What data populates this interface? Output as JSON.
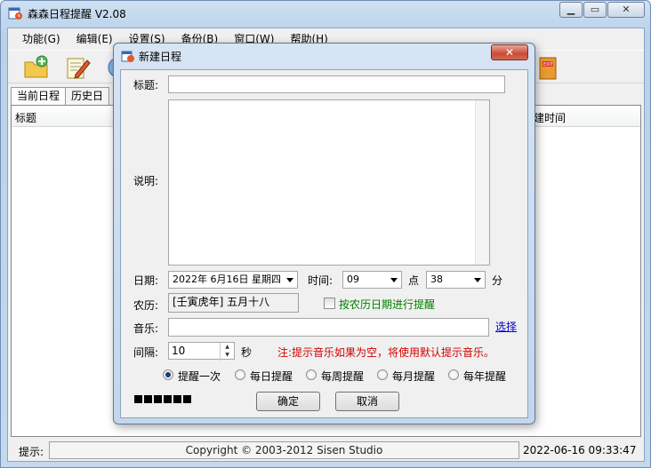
{
  "app": {
    "title": "森森日程提醒 V2.08",
    "window_buttons": [
      "▁",
      "▭",
      "✕"
    ]
  },
  "menu": [
    "功能(G)",
    "编辑(E)",
    "设置(S)",
    "备份(B)",
    "窗口(W)",
    "帮助(H)"
  ],
  "tabs": [
    "当前日程",
    "历史日"
  ],
  "list": {
    "col_title": "标题",
    "col_created": "建时间"
  },
  "status": {
    "label": "提示:",
    "message": "Copyright © 2003-2012 Sisen Studio",
    "datetime": "2022-06-16 09:33:47"
  },
  "dialog": {
    "title": "新建日程",
    "close": "✕",
    "title_label": "标题:",
    "title_value": "",
    "desc_label": "说明:",
    "desc_value": "",
    "date_label": "日期:",
    "date_value": "2022年 6月16日 星期四",
    "time_label": "时间:",
    "hour_value": "09",
    "hour_unit": "点",
    "minute_value": "38",
    "minute_unit": "分",
    "lunar_label": "农历:",
    "lunar_value": "[壬寅虎年] 五月十八",
    "lunar_check_label": "按农历日期进行提醒",
    "lunar_checked": false,
    "music_label": "音乐:",
    "music_value": "",
    "music_browse": "选择",
    "interval_label": "间隔:",
    "interval_value": "10",
    "interval_unit": "秒",
    "note": "注:提示音乐如果为空，将使用默认提示音乐。",
    "repeat_options": [
      "提醒一次",
      "每日提醒",
      "每周提醒",
      "每月提醒",
      "每年提醒"
    ],
    "repeat_selected": "提醒一次",
    "ok": "确定",
    "cancel": "取消"
  },
  "colors": {
    "note_red": "#d40000",
    "lunar_green": "#008000",
    "link_blue": "#0000cc"
  }
}
